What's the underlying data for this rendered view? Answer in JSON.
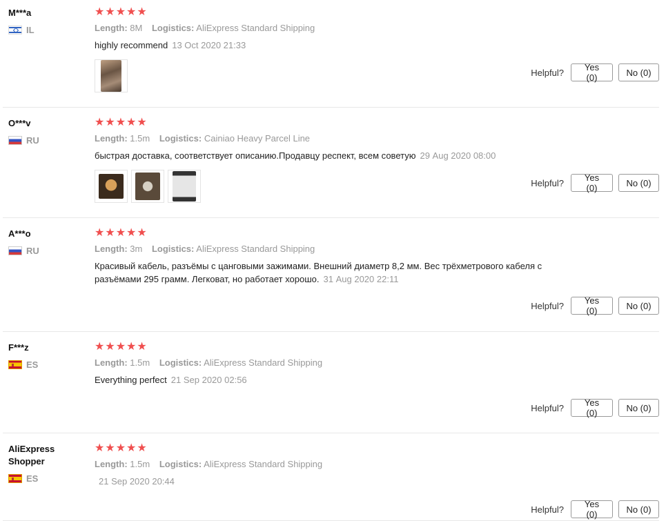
{
  "labels": {
    "length": "Length:",
    "logistics": "Logistics:",
    "helpful": "Helpful?"
  },
  "colors": {
    "star": "#f04f4f",
    "muted": "#999999"
  },
  "reviews": [
    {
      "name": "M***a",
      "country": "IL",
      "flag": "israel-flag-icon",
      "stars": "★★★★★",
      "rating": 5,
      "length": "8M",
      "logistics": "AliExpress Standard Shipping",
      "text": "highly recommend",
      "date": "13 Oct 2020 21:33",
      "yes": "Yes (0)",
      "no": "No (0)"
    },
    {
      "name": "O***v",
      "country": "RU",
      "flag": "russia-flag-icon",
      "stars": "★★★★★",
      "rating": 5,
      "length": "1.5m",
      "logistics": "Cainiao Heavy Parcel Line",
      "text": "быстрая доставка, соответствует описанию.Продавцу респект, всем советую",
      "date": "29 Aug 2020 08:00",
      "yes": "Yes (0)",
      "no": "No (0)"
    },
    {
      "name": "A***o",
      "country": "RU",
      "flag": "russia-flag-icon",
      "stars": "★★★★★",
      "rating": 5,
      "length": "3m",
      "logistics": "AliExpress Standard Shipping",
      "text": "Красивый кабель, разъёмы с цанговыми зажимами. Внешний диаметр 8,2 мм. Вес трёхметрового кабеля с разъёмами 295 грамм. Легковат, но работает хорошо.",
      "date": "31 Aug 2020 22:11",
      "yes": "Yes (0)",
      "no": "No (0)"
    },
    {
      "name": "F***z",
      "country": "ES",
      "flag": "spain-flag-icon",
      "stars": "★★★★★",
      "rating": 5,
      "length": "1.5m",
      "logistics": "AliExpress Standard Shipping",
      "text": "Everything perfect",
      "date": "21 Sep 2020 02:56",
      "yes": "Yes (0)",
      "no": "No (0)"
    },
    {
      "name": "AliExpress Shopper",
      "country": "ES",
      "flag": "spain-flag-icon",
      "stars": "★★★★★",
      "rating": 5,
      "length": "1.5m",
      "logistics": "AliExpress Standard Shipping",
      "text": "",
      "date": "21 Sep 2020 20:44",
      "yes": "Yes (0)",
      "no": "No (0)"
    }
  ]
}
